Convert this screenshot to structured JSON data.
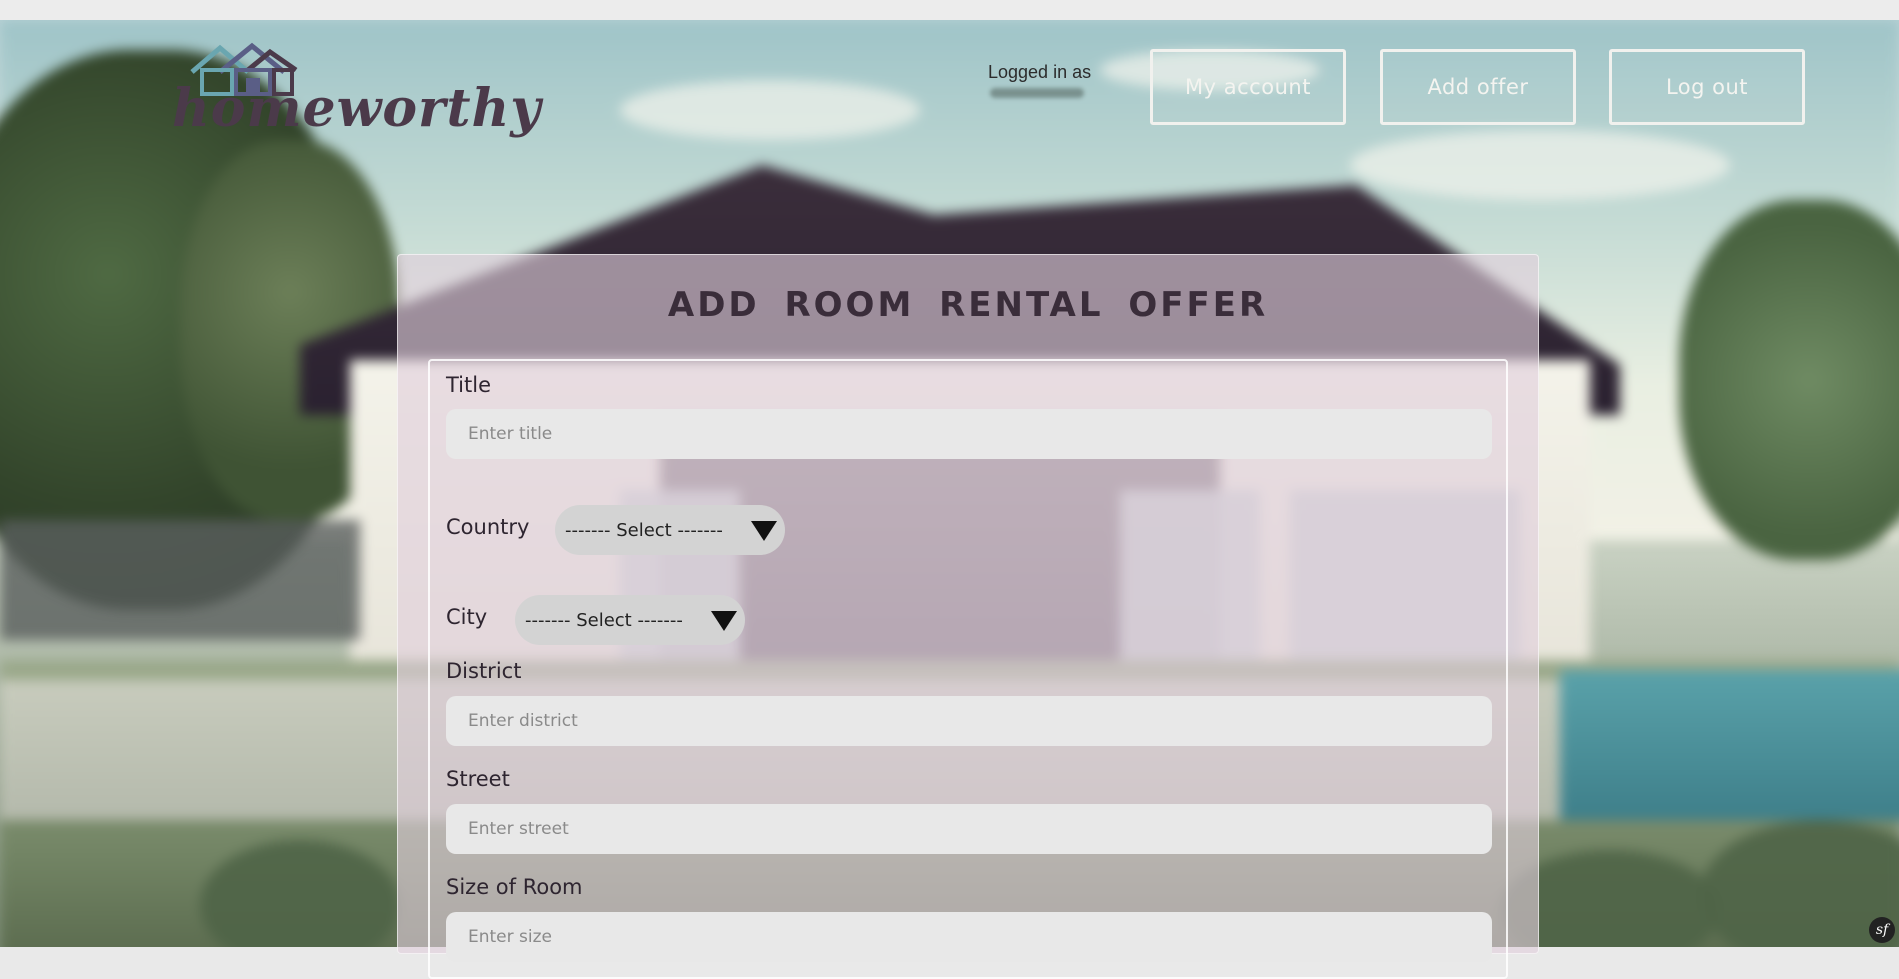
{
  "brand": {
    "name": "homeworthy",
    "logo_icon": "houses-icon"
  },
  "header": {
    "logged_in_label": "Logged in as",
    "buttons": {
      "my_account": "My account",
      "add_offer": "Add offer",
      "log_out": "Log out"
    }
  },
  "form": {
    "title": "ADD ROOM RENTAL OFFER",
    "fields": {
      "title": {
        "label": "Title",
        "placeholder": "Enter title"
      },
      "country": {
        "label": "Country",
        "selected": "------- Select -------"
      },
      "city": {
        "label": "City",
        "selected": "------- Select -------"
      },
      "district": {
        "label": "District",
        "placeholder": "Enter district"
      },
      "street": {
        "label": "Street",
        "placeholder": "Enter street"
      },
      "size": {
        "label": "Size of Room",
        "placeholder": "Enter size"
      }
    }
  },
  "toolbar_icon": {
    "symbol": "sf",
    "name": "symfony-toolbar-icon"
  },
  "colors": {
    "panel": "#e0cedc",
    "title": "#3a2d3a",
    "logo": "#4b3a4a",
    "button_border": "#f1f1ee"
  }
}
